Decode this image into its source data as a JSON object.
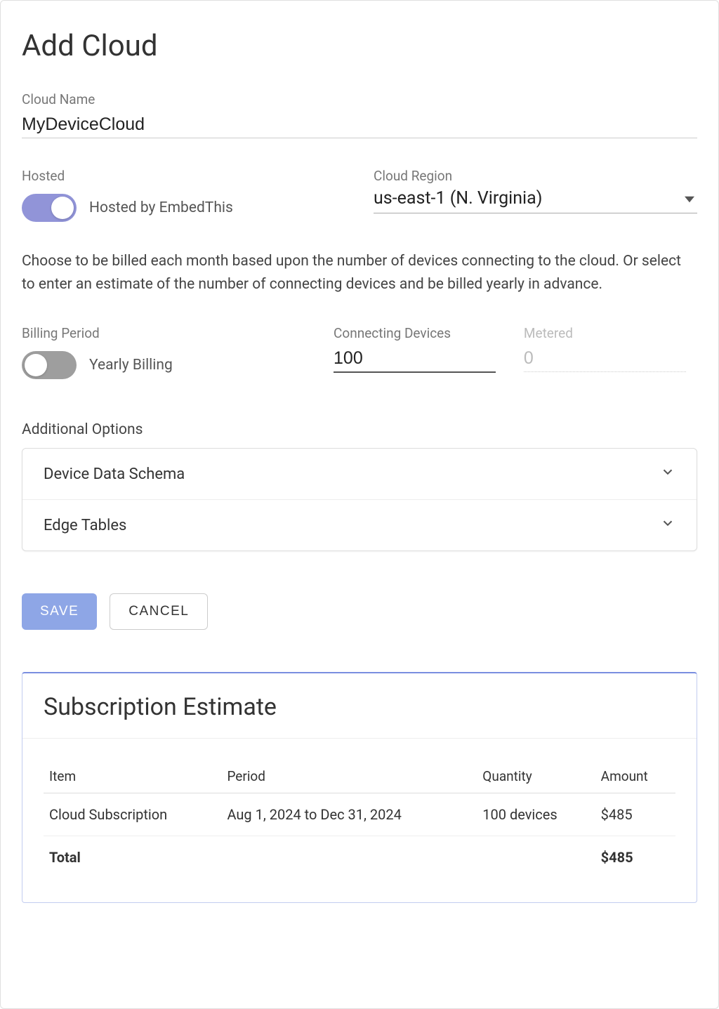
{
  "page": {
    "title": "Add Cloud"
  },
  "cloud_name": {
    "label": "Cloud Name",
    "value": "MyDeviceCloud"
  },
  "hosted": {
    "label": "Hosted",
    "toggle_label": "Hosted by EmbedThis",
    "on": true
  },
  "region": {
    "label": "Cloud Region",
    "value": "us-east-1 (N. Virginia)"
  },
  "description": "Choose to be billed each month based upon the number of devices connecting to the cloud. Or select to enter an estimate of the number of connecting devices and be billed yearly in advance.",
  "billing_period": {
    "label": "Billing Period",
    "toggle_label": "Yearly Billing",
    "on": false
  },
  "connecting_devices": {
    "label": "Connecting Devices",
    "value": "100"
  },
  "metered": {
    "label": "Metered",
    "value": "0"
  },
  "additional_options": {
    "title": "Additional Options",
    "items": [
      "Device Data Schema",
      "Edge Tables"
    ]
  },
  "buttons": {
    "save": "Save",
    "cancel": "Cancel"
  },
  "estimate": {
    "title": "Subscription Estimate",
    "headers": {
      "item": "Item",
      "period": "Period",
      "quantity": "Quantity",
      "amount": "Amount"
    },
    "rows": [
      {
        "item": "Cloud Subscription",
        "period": "Aug 1, 2024 to Dec 31, 2024",
        "quantity": "100 devices",
        "amount": "$485"
      }
    ],
    "total_label": "Total",
    "total_amount": "$485"
  }
}
